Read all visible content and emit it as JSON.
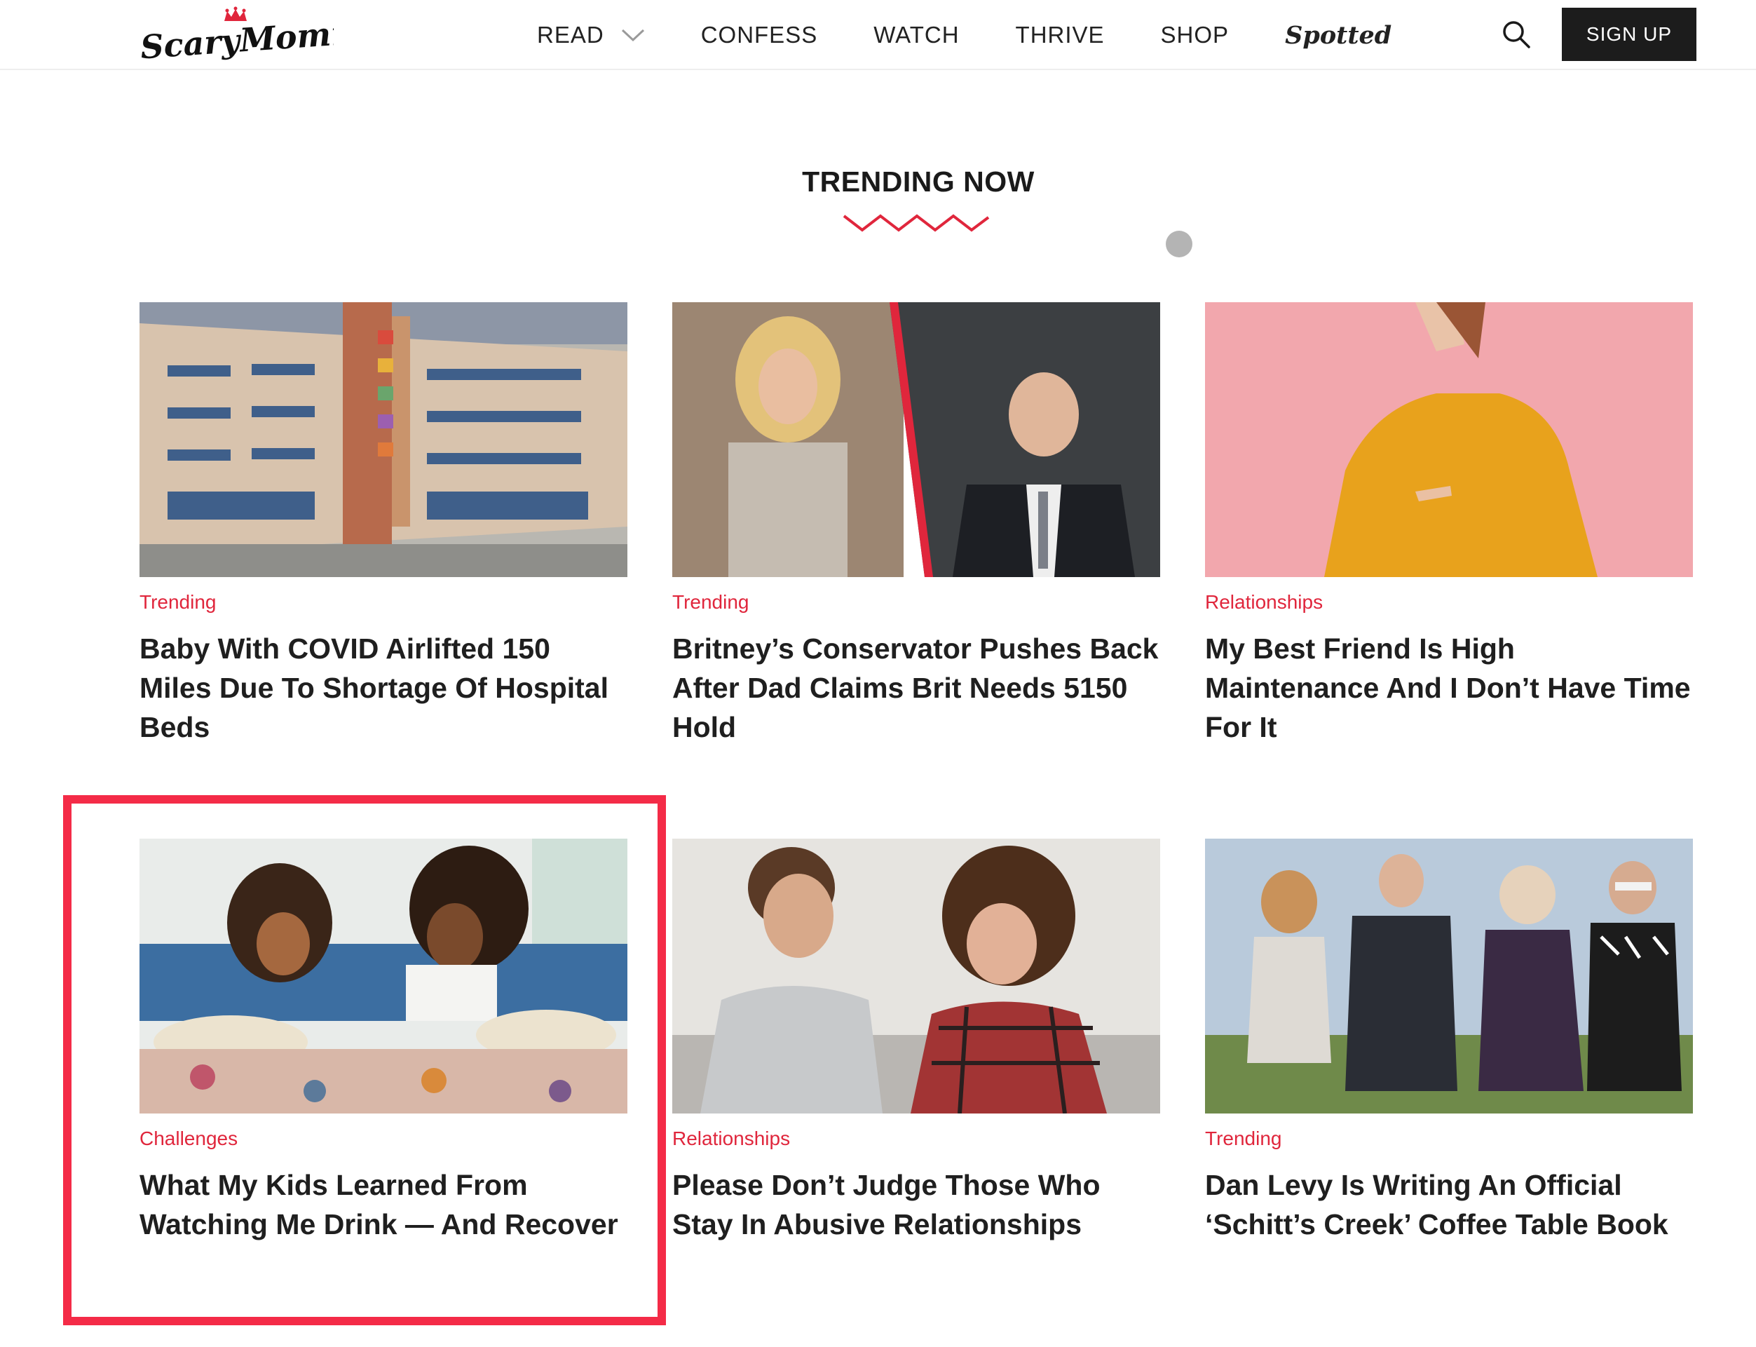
{
  "site": {
    "logo_text": "ScaryMommy"
  },
  "nav": {
    "items": [
      "READ",
      "CONFESS",
      "WATCH",
      "THRIVE",
      "SHOP"
    ],
    "spotted": "Spotted",
    "signup": "SIGN UP"
  },
  "colors": {
    "accent": "#e0263c",
    "highlight": "#f42b47",
    "button": "#1c1c1c"
  },
  "section": {
    "title": "TRENDING NOW"
  },
  "articles": [
    {
      "category": "Trending",
      "title": "Baby With COVID Airlifted 150 Miles Due To Shortage Of Hospital Beds",
      "image": "hospital-building"
    },
    {
      "category": "Trending",
      "title": "Britney’s Conservator Pushes Back After Dad Claims Brit Needs 5150 Hold",
      "image": "britney-and-father"
    },
    {
      "category": "Relationships",
      "title": "My Best Friend Is High Maintenance And I Don’t Have Time For It",
      "image": "woman-yellow-sweater"
    },
    {
      "category": "Challenges",
      "title": "What My Kids Learned From Watching Me Drink — And Recover",
      "image": "mother-daughter-bed"
    },
    {
      "category": "Relationships",
      "title": "Please Don’t Judge Those Who Stay In Abusive Relationships",
      "image": "upset-couple-couch"
    },
    {
      "category": "Trending",
      "title": "Dan Levy Is Writing An Official ‘Schitt’s Creek’ Coffee Table Book",
      "image": "schitts-creek-cast"
    }
  ]
}
